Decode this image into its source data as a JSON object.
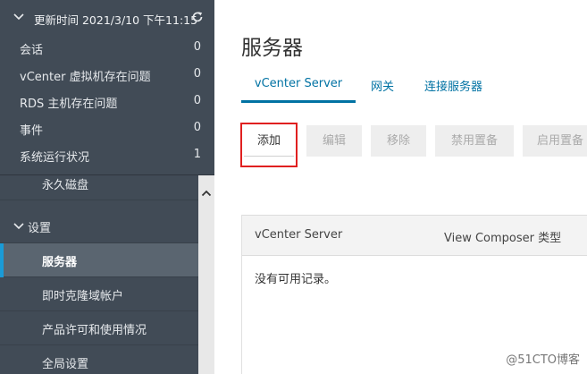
{
  "sidebar": {
    "status_title": "更新时间 2021/3/10 下午11:15",
    "stats": [
      {
        "label": "会话",
        "count": "0"
      },
      {
        "label": "vCenter 虚拟机存在问题",
        "count": "0"
      },
      {
        "label": "RDS 主机存在问题",
        "count": "0"
      },
      {
        "label": "事件",
        "count": "0"
      },
      {
        "label": "系统运行状况",
        "count": "1"
      }
    ],
    "nav": {
      "partial_item": "永久磁盘",
      "section_label": "设置",
      "items": [
        {
          "label": "服务器",
          "active": true
        },
        {
          "label": "即时克隆域帐户",
          "active": false
        },
        {
          "label": "产品许可和使用情况",
          "active": false
        },
        {
          "label": "全局设置",
          "active": false
        }
      ]
    }
  },
  "main": {
    "title": "服务器",
    "tabs": [
      {
        "label": "vCenter Server",
        "active": true
      },
      {
        "label": "网关",
        "active": false
      },
      {
        "label": "连接服务器",
        "active": false
      }
    ],
    "toolbar": {
      "add": "添加",
      "edit": "编辑",
      "remove": "移除",
      "disable_provisioning": "禁用置备",
      "enable_provisioning": "启用置备"
    },
    "grid": {
      "columns": [
        "vCenter Server",
        "View Composer 类型"
      ],
      "empty_text": "没有可用记录。"
    }
  },
  "watermark": "@51CTO博客",
  "colors": {
    "sidebar_bg": "#414b56",
    "active_item_bg": "#5a6570",
    "accent": "#0072a3",
    "highlight_border": "#e02020"
  }
}
